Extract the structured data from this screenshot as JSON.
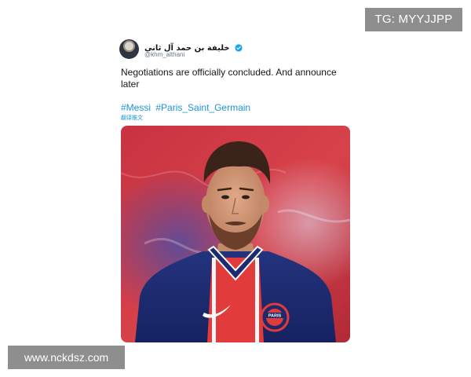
{
  "watermarks": {
    "telegram": "TG: MYYJJPP",
    "site": "www.nckdsz.com"
  },
  "tweet": {
    "author": {
      "display_name": "خليفة بن حمد آل ثاني",
      "handle": "@khm_althani",
      "verified": true
    },
    "text": "Negotiations are officially concluded. And announce later",
    "hashtags": [
      "#Messi",
      "#Paris_Saint_Germain"
    ],
    "translate_label": "翻译推文",
    "media": {
      "kind": "photo",
      "jersey_crest": "PARIS"
    }
  },
  "colors": {
    "link": "#1b95e0",
    "verified": "#1da1f2",
    "badge_bg": "#8e8e8e",
    "jersey_navy": "#1a2a6c",
    "jersey_red": "#e23b3b",
    "background_red": "#c8323f"
  }
}
